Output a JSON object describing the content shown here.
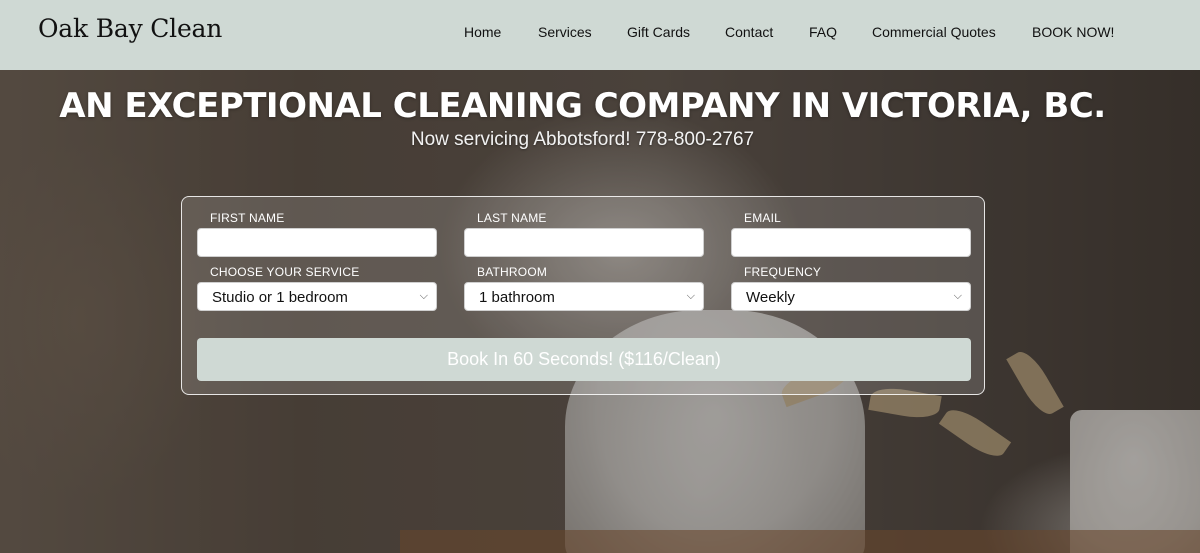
{
  "brand": {
    "name": "Oak Bay Clean"
  },
  "nav": {
    "items": [
      {
        "label": "Home"
      },
      {
        "label": "Services"
      },
      {
        "label": "Gift Cards"
      },
      {
        "label": "Contact"
      },
      {
        "label": "FAQ"
      },
      {
        "label": "Commercial Quotes"
      },
      {
        "label": "BOOK NOW!"
      }
    ]
  },
  "hero": {
    "title": "AN EXCEPTIONAL CLEANING COMPANY IN VICTORIA, BC.",
    "subtitle": "Now servicing Abbotsford! 778-800-2767"
  },
  "form": {
    "first_name": {
      "label": "FIRST NAME",
      "value": ""
    },
    "last_name": {
      "label": "LAST NAME",
      "value": ""
    },
    "email": {
      "label": "EMAIL",
      "value": ""
    },
    "service": {
      "label": "CHOOSE YOUR SERVICE",
      "selected": "Studio or 1 bedroom"
    },
    "bathroom": {
      "label": "BATHROOM",
      "selected": "1 bathroom"
    },
    "frequency": {
      "label": "FREQUENCY",
      "selected": "Weekly"
    },
    "submit_label": "Book In 60 Seconds! ($116/Clean)"
  },
  "colors": {
    "header_bg": "#cfd9d4",
    "button_bg": "#cfd9d4",
    "text_dark": "#111111",
    "text_light": "#ffffff"
  }
}
